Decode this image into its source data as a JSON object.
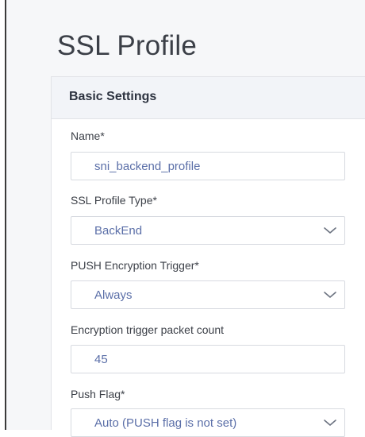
{
  "page": {
    "title": "SSL Profile"
  },
  "section": {
    "title": "Basic Settings"
  },
  "fields": {
    "name": {
      "label": "Name*",
      "value": "sni_backend_profile"
    },
    "profile_type": {
      "label": "SSL Profile Type*",
      "value": "BackEnd"
    },
    "push_trigger": {
      "label": "PUSH Encryption Trigger*",
      "value": "Always"
    },
    "packet_count": {
      "label": "Encryption trigger packet count",
      "value": "45"
    },
    "push_flag": {
      "label": "Push Flag*",
      "value": "Auto (PUSH flag is not set)"
    }
  },
  "icons": {
    "dropdown": "chevron-down-icon"
  },
  "colors": {
    "value_text": "#5b6fa8",
    "header_bg": "#f2f4f8",
    "border": "#d7dae0"
  }
}
